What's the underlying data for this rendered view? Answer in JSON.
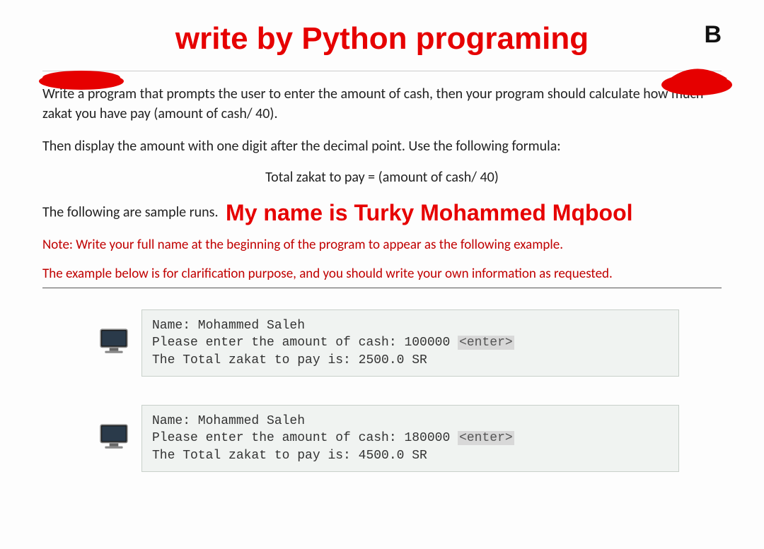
{
  "header": {
    "title": "write by Python programing",
    "corner": "B"
  },
  "body": {
    "p1": "Write a program that prompts the user to enter the amount of cash, then your program should calculate how much zakat you have pay (amount of cash/ 40).",
    "p2": "Then display the amount with one digit after the decimal point. Use the following formula:",
    "formula": "Total zakat to pay = (amount of cash/ 40)",
    "sample_intro": "The following are sample runs.",
    "name_red": "My name is Turky  Mohammed Mqbool",
    "note1": "Note: Write your full name at the beginning of the program to appear as the following example.",
    "note2": "The example below is for clarification purpose, and you should write your own information as requested."
  },
  "runs": [
    {
      "line1": "Name: Mohammed Saleh",
      "line2a": "Please enter the amount of cash: 100000 ",
      "enter": "<enter>",
      "line3": "The Total zakat to pay is: 2500.0 SR"
    },
    {
      "line1": "Name: Mohammed Saleh",
      "line2a": "Please enter the amount of cash: 180000 ",
      "enter": "<enter>",
      "line3": "The Total zakat to pay is: 4500.0 SR"
    }
  ]
}
